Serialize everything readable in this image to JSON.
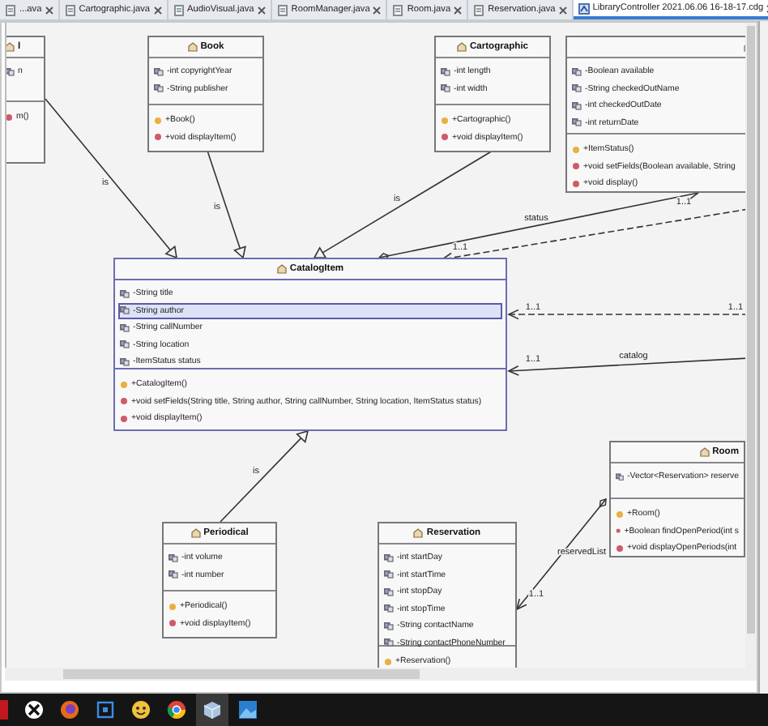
{
  "tabs": [
    {
      "label": "...ava",
      "selected": false
    },
    {
      "label": "Cartographic.java",
      "selected": false
    },
    {
      "label": "AudioVisual.java",
      "selected": false
    },
    {
      "label": "RoomManager.java",
      "selected": false
    },
    {
      "label": "Room.java",
      "selected": false
    },
    {
      "label": "Reservation.java",
      "selected": false
    },
    {
      "label": "LibraryController 2021.06.06 16-18-17.cdg",
      "selected": true
    }
  ],
  "diagram": {
    "classes": [
      {
        "name": "l",
        "selected": false,
        "attributes": [
          {
            "text": "n",
            "selected": false
          }
        ],
        "methods": [
          {
            "text": "m()",
            "kind": "method"
          }
        ]
      },
      {
        "name": "Book",
        "selected": false,
        "attributes": [
          {
            "text": "-int copyrightYear",
            "selected": false
          },
          {
            "text": "-String publisher",
            "selected": false
          }
        ],
        "methods": [
          {
            "text": "+Book()",
            "kind": "constructor"
          },
          {
            "text": "+void displayItem()",
            "kind": "method"
          }
        ]
      },
      {
        "name": "Cartographic",
        "selected": false,
        "attributes": [
          {
            "text": "-int length",
            "selected": false
          },
          {
            "text": "-int width",
            "selected": false
          }
        ],
        "methods": [
          {
            "text": "+Cartographic()",
            "kind": "constructor"
          },
          {
            "text": "+void displayItem()",
            "kind": "method"
          }
        ]
      },
      {
        "selected": false,
        "attributes": [
          {
            "text": "-Boolean available",
            "selected": false
          },
          {
            "text": "-String checkedOutName",
            "selected": false
          },
          {
            "text": "-int checkedOutDate",
            "selected": false
          },
          {
            "text": "-int returnDate",
            "selected": false
          }
        ],
        "methods": [
          {
            "text": "+ItemStatus()",
            "kind": "constructor"
          },
          {
            "text": "+void setFields(Boolean available, String",
            "kind": "method"
          },
          {
            "text": "+void display()",
            "kind": "method"
          }
        ]
      },
      {
        "name": "CatalogItem",
        "selected": true,
        "attributes": [
          {
            "text": "-String title",
            "selected": false
          },
          {
            "text": "-String author",
            "selected": true
          },
          {
            "text": "-String callNumber",
            "selected": false
          },
          {
            "text": "-String location",
            "selected": false
          },
          {
            "text": "-ItemStatus status",
            "selected": false
          }
        ],
        "methods": [
          {
            "text": "+CatalogItem()",
            "kind": "constructor"
          },
          {
            "text": "+void setFields(String title, String author, String callNumber, String location, ItemStatus status)",
            "kind": "method"
          },
          {
            "text": "+void displayItem()",
            "kind": "method"
          }
        ]
      },
      {
        "name": "Periodical",
        "selected": false,
        "attributes": [
          {
            "text": "-int volume",
            "selected": false
          },
          {
            "text": "-int number",
            "selected": false
          }
        ],
        "methods": [
          {
            "text": "+Periodical()",
            "kind": "constructor"
          },
          {
            "text": "+void displayItem()",
            "kind": "method"
          }
        ]
      },
      {
        "name": "Reservation",
        "selected": false,
        "attributes": [
          {
            "text": "-int startDay",
            "selected": false
          },
          {
            "text": "-int startTime",
            "selected": false
          },
          {
            "text": "-int stopDay",
            "selected": false
          },
          {
            "text": "-int stopTime",
            "selected": false
          },
          {
            "text": "-String contactName",
            "selected": false
          },
          {
            "text": "-String contactPhoneNumber",
            "selected": false
          }
        ],
        "methods": [
          {
            "text": "+Reservation()",
            "kind": "constructor"
          }
        ]
      },
      {
        "name": "Room",
        "selected": false,
        "attributes": [
          {
            "text": "-Vector<Reservation> reserve",
            "selected": false
          }
        ],
        "methods": [
          {
            "text": "+Room()",
            "kind": "constructor"
          },
          {
            "text": "+Boolean findOpenPeriod(int s",
            "kind": "method"
          },
          {
            "text": "+void displayOpenPeriods(int",
            "kind": "method"
          }
        ]
      }
    ],
    "edges": [
      {
        "kind": "generalization",
        "labels": [
          "is"
        ]
      },
      {
        "kind": "generalization",
        "labels": [
          "is"
        ]
      },
      {
        "kind": "generalization",
        "labels": [
          "is"
        ]
      },
      {
        "kind": "association",
        "labels": [
          "status",
          "1..1",
          "1..1"
        ]
      },
      {
        "kind": "dependency"
      },
      {
        "kind": "dependency",
        "labels": [
          "1..1",
          "1..1"
        ]
      },
      {
        "kind": "navigation",
        "labels": [
          "1..1",
          "catalog"
        ]
      },
      {
        "kind": "generalization",
        "labels": [
          "is"
        ]
      },
      {
        "kind": "association",
        "labels": [
          "reservedList",
          "1..1"
        ]
      }
    ]
  }
}
